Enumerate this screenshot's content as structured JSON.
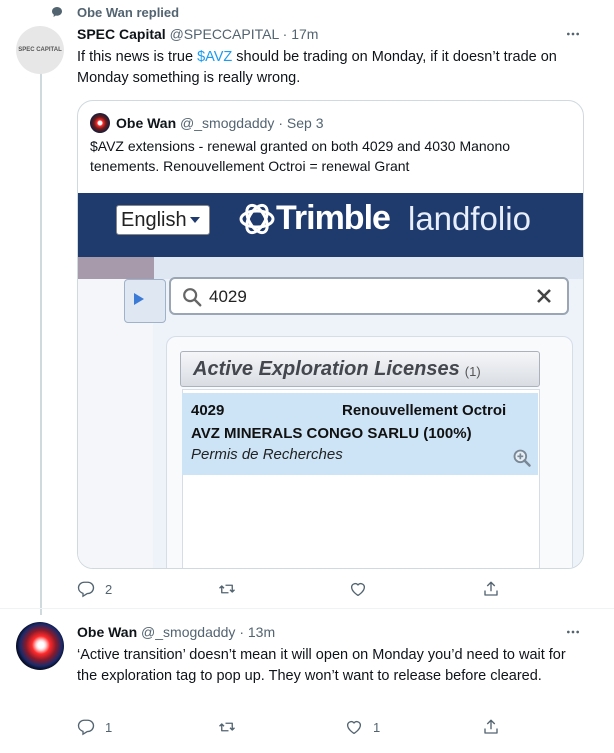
{
  "context": {
    "text": "Obe Wan replied"
  },
  "tweet1": {
    "author_name": "SPEC Capital",
    "author_handle": "@SPECCAPITAL",
    "time": "17m",
    "avatar_text": "SPEC CAPITAL",
    "text_before": "If this news is true ",
    "cashtag": "$AVZ",
    "text_after": " should be trading on Monday, if it doesn’t trade on Monday something is really wrong.",
    "quote": {
      "author_name": "Obe Wan",
      "author_handle": "@_smogdaddy",
      "date": "Sep 3",
      "text": "$AVZ extensions - renewal granted on both 4029 and 4030 Manono tenements. Renouvellement Octroi = renewal Grant",
      "image": {
        "language": "English",
        "brand": "Trimble",
        "product": "landfolio",
        "search_value": "4029",
        "panel_title": "Active Exploration Licenses",
        "panel_count": "(1)",
        "result_number": "4029",
        "result_status": "Renouvellement Octroi",
        "result_holder": "AVZ MINERALS CONGO SARLU (100%)",
        "result_type": "Permis de Recherches"
      }
    },
    "actions": {
      "replies": "2",
      "retweets": "",
      "likes": ""
    }
  },
  "tweet2": {
    "author_name": "Obe Wan",
    "author_handle": "@_smogdaddy",
    "time": "13m",
    "text": "‘Active transition’ doesn’t mean it will open on Monday you’d need to wait for the exploration tag to pop up. They won’t want to release before cleared.",
    "actions": {
      "replies": "1",
      "retweets": "",
      "likes": "1"
    }
  },
  "colors": {
    "accent": "#1d9bf0",
    "muted": "#536471",
    "landfolio_header": "#1f3b6e",
    "result_bg": "#cde4f7"
  }
}
